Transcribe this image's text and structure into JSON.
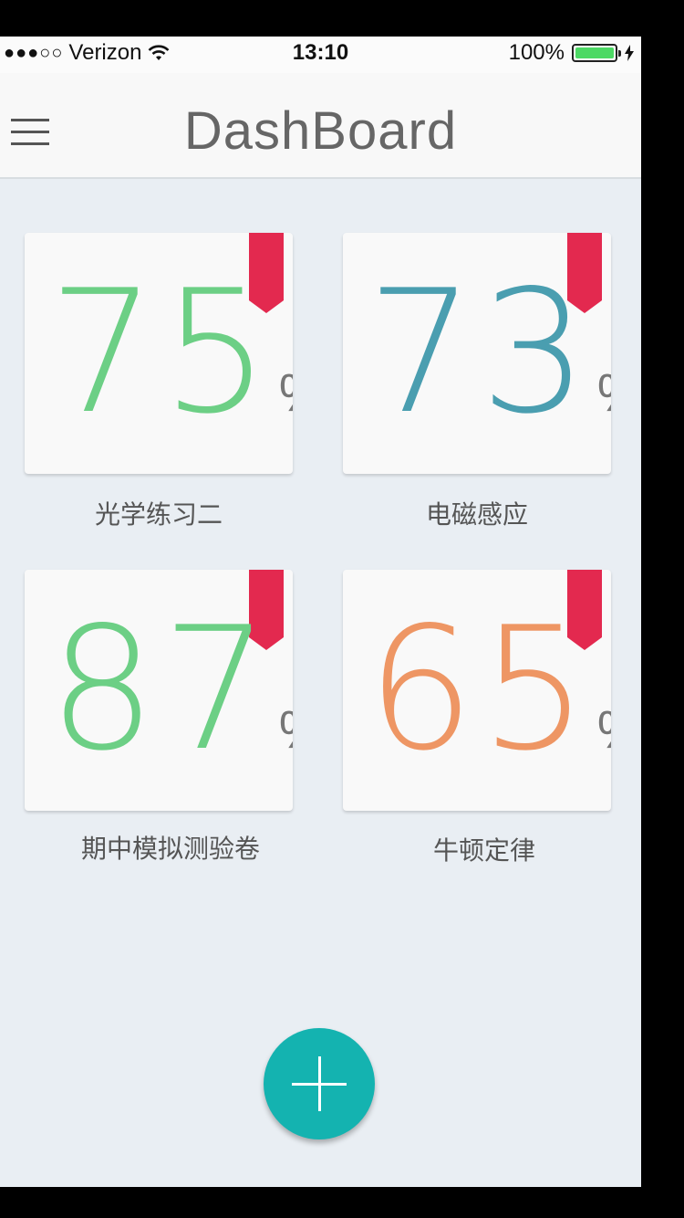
{
  "statusbar": {
    "signal": "●●●○○",
    "carrier": "Verizon",
    "time": "13:10",
    "battery_percent": "100%",
    "battery_level": 1.0
  },
  "navbar": {
    "title": "DashBoard",
    "menu_icon": "hamburger-icon"
  },
  "colors": {
    "green": "#6ccf85",
    "teal": "#4a9eb0",
    "orange": "#ee9664",
    "ribbon": "#e3294f",
    "fab": "#14b3b0"
  },
  "cards": [
    {
      "value": "75",
      "unit": "%",
      "label": "光学练习二",
      "color": "#6ccf85"
    },
    {
      "value": "73",
      "unit": "%",
      "label": "电磁感应",
      "color": "#4a9eb0"
    },
    {
      "value": "87",
      "unit": "%",
      "label": "期中模拟测验卷",
      "color": "#6ccf85"
    },
    {
      "value": "65",
      "unit": "%",
      "label": "牛顿定律",
      "color": "#ee9664"
    }
  ],
  "fab": {
    "icon": "plus-icon"
  }
}
